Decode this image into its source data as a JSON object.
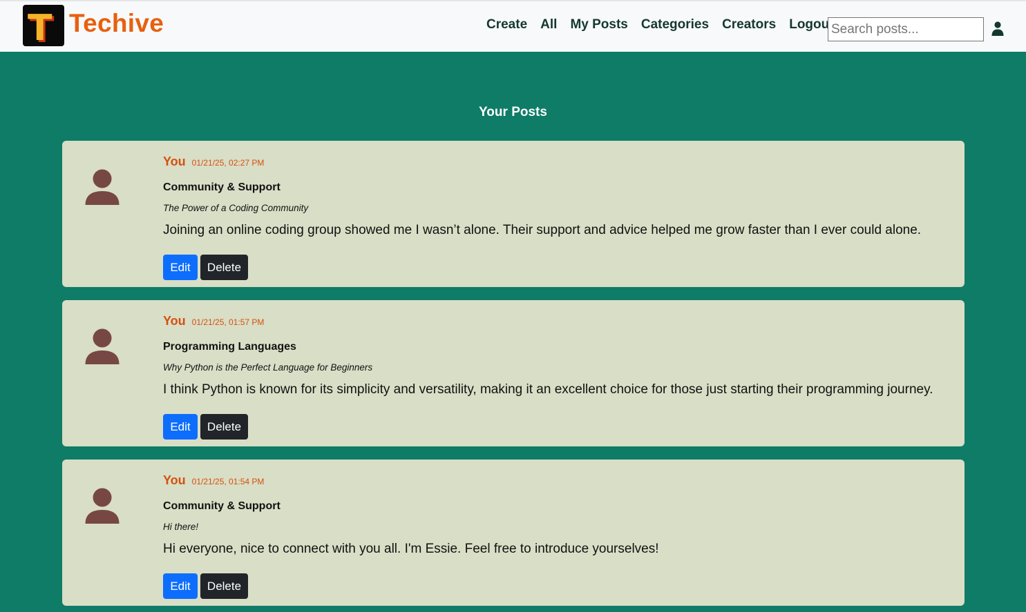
{
  "app": {
    "logo_letter": "T",
    "brand": "Techive"
  },
  "nav": {
    "links": [
      "Create",
      "All",
      "My Posts",
      "Categories",
      "Creators",
      "Logout"
    ]
  },
  "search": {
    "placeholder": "Search posts..."
  },
  "icons": {
    "user": "user-icon",
    "avatar": "avatar-icon"
  },
  "colors": {
    "page_background": "#0e7c67",
    "brand": "#e8600e",
    "card_background": "#d9dec6",
    "avatar": "#774843",
    "edit_button": "#0d6efd",
    "delete_button": "#212529"
  },
  "main": {
    "title": "Your Posts"
  },
  "posts": [
    {
      "author": "You",
      "date": "01/21/25, 02:27 PM",
      "category": "Community & Support",
      "title": "The Power of a Coding Community",
      "body": "Joining an online coding group showed me I wasn’t alone. Their support and advice helped me grow faster than I ever could alone.",
      "edit_label": "Edit",
      "delete_label": "Delete"
    },
    {
      "author": "You",
      "date": "01/21/25, 01:57 PM",
      "category": "Programming Languages",
      "title": "Why Python is the Perfect Language for Beginners",
      "body": "I think Python is known for its simplicity and versatility, making it an excellent choice for those just starting their programming journey.",
      "edit_label": "Edit",
      "delete_label": "Delete"
    },
    {
      "author": "You",
      "date": "01/21/25, 01:54 PM",
      "category": "Community & Support",
      "title": "Hi there!",
      "body": "Hi everyone, nice to connect with you all. I'm Essie. Feel free to introduce yourselves!",
      "edit_label": "Edit",
      "delete_label": "Delete"
    }
  ]
}
